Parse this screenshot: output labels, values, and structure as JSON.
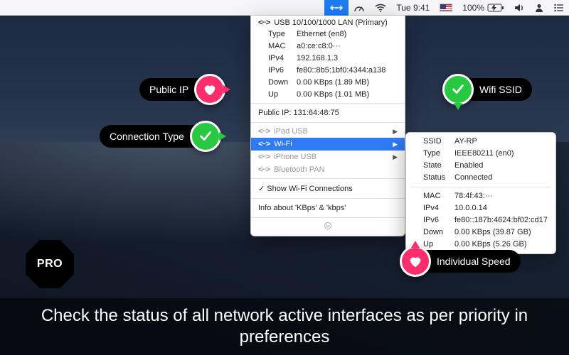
{
  "menubar": {
    "clock": "Tue 9:41",
    "battery_pct": "100%"
  },
  "dropdown": {
    "primary": {
      "title": "USB 10/100/1000 LAN (Primary)",
      "rows": [
        {
          "k": "Type",
          "v": "Ethernet (en8)"
        },
        {
          "k": "MAC",
          "v": "a0:ce:c8:0···"
        },
        {
          "k": "IPv4",
          "v": "192.168.1.3"
        },
        {
          "k": "IPv6",
          "v": "fe80::8b5:1bf0:4344:a138"
        },
        {
          "k": "Down",
          "v": "0.00 KBps (1.89 MB)"
        },
        {
          "k": "Up",
          "v": "0.00 KBps (1.01 MB)"
        }
      ]
    },
    "public_ip_label": "Public IP: 131:64:48:75",
    "interfaces": [
      {
        "label": "iPad USB",
        "dim": true
      },
      {
        "label": "Wi-Fi",
        "selected": true
      },
      {
        "label": "iPhone USB",
        "dim": true
      },
      {
        "label": "Bluetooth PAN",
        "dim": true
      }
    ],
    "show_wifi": "Show Wi-Fi Connections",
    "info": "Info about 'KBps' & 'kbps'"
  },
  "submenu": {
    "top": [
      {
        "k": "SSID",
        "v": "AY-RP"
      },
      {
        "k": "Type",
        "v": "IEEE80211 (en0)"
      },
      {
        "k": "State",
        "v": "Enabled"
      },
      {
        "k": "Status",
        "v": "Connected"
      }
    ],
    "bottom": [
      {
        "k": "MAC",
        "v": "78:4f:43:···"
      },
      {
        "k": "IPv4",
        "v": "10.0.0.14"
      },
      {
        "k": "IPv6",
        "v": "fe80::187b:4624:bf02:cd17"
      }
    ],
    "speed": [
      {
        "k": "Down",
        "v": "0.00 KBps (39.87 GB)"
      },
      {
        "k": "Up",
        "v": "0.00 KBps (5.26 GB)"
      }
    ]
  },
  "callouts": {
    "public_ip": "Public IP",
    "conn_type": "Connection Type",
    "wifi_ssid": "Wifi SSID",
    "ind_speed": "Individual Speed"
  },
  "pro": "PRO",
  "caption": "Check the status of all network active interfaces as per priority in preferences"
}
